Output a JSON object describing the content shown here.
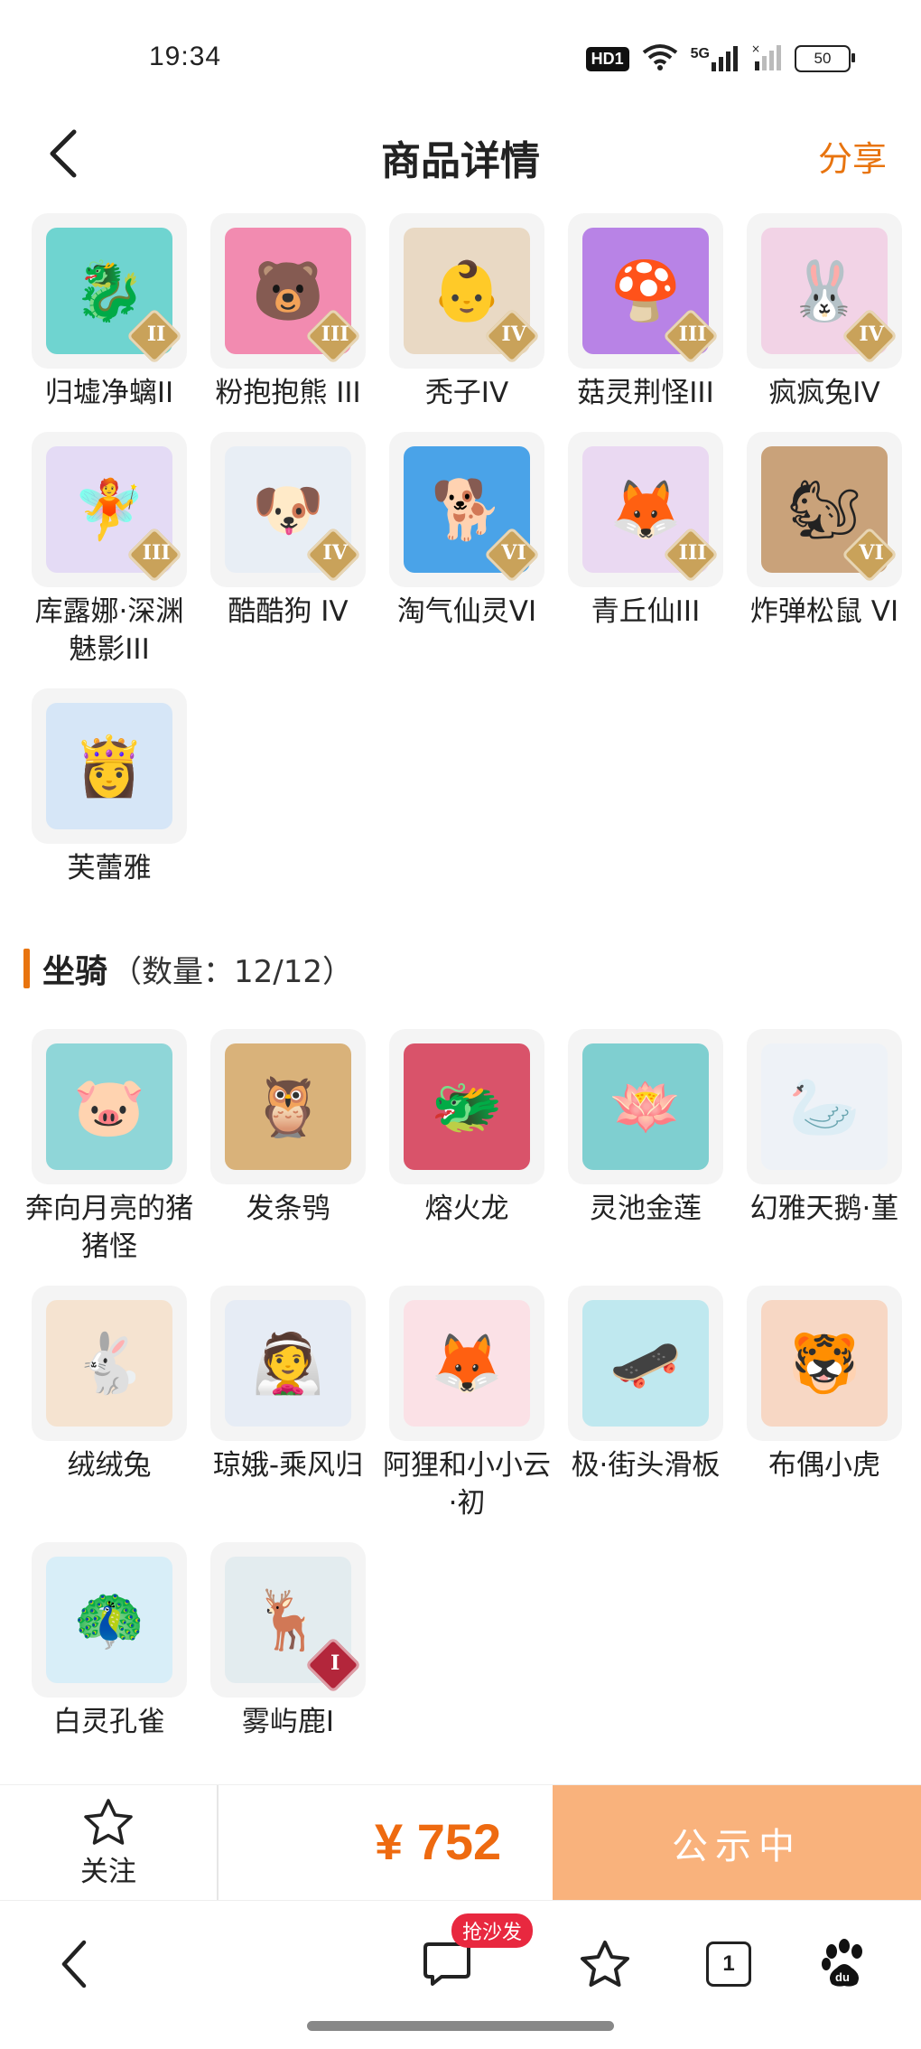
{
  "status_bar": {
    "time": "19:34",
    "hd_label": "HD1",
    "network_label": "5G",
    "battery": "50"
  },
  "header": {
    "title": "商品详情",
    "share_label": "分享"
  },
  "pets": {
    "items": [
      {
        "name": "归墟净螭II",
        "tier": "II",
        "color": "#6fd4d0",
        "emoji": "🐉"
      },
      {
        "name": "粉抱抱熊 III",
        "tier": "III",
        "color": "#f28bb0",
        "emoji": "🐻"
      },
      {
        "name": "秃子IV",
        "tier": "IV",
        "color": "#e9d9c4",
        "emoji": "👶"
      },
      {
        "name": "菇灵荆怪III",
        "tier": "III",
        "color": "#b883e6",
        "emoji": "🍄"
      },
      {
        "name": "疯疯兔IV",
        "tier": "IV",
        "color": "#f2d3e6",
        "emoji": "🐰"
      },
      {
        "name": "库露娜·深渊魅影III",
        "tier": "III",
        "color": "#e4dbf5",
        "emoji": "🧚"
      },
      {
        "name": "酷酷狗 IV",
        "tier": "IV",
        "color": "#e8eef5",
        "emoji": "🐶"
      },
      {
        "name": "淘气仙灵VI",
        "tier": "VI",
        "color": "#4aa3e8",
        "emoji": "🐕"
      },
      {
        "name": "青丘仙III",
        "tier": "III",
        "color": "#ead9f2",
        "emoji": "🦊"
      },
      {
        "name": "炸弹松鼠 VI",
        "tier": "VI",
        "color": "#c9a27a",
        "emoji": "🐿"
      },
      {
        "name": "芙蕾雅",
        "tier": "",
        "color": "#d6e6f7",
        "emoji": "👸"
      }
    ]
  },
  "mounts_section": {
    "title": "坐骑",
    "count_label": "（数量：12/12）"
  },
  "mounts": {
    "items": [
      {
        "name": "奔向月亮的猪猪怪",
        "tier": "",
        "color": "#8fd6d8",
        "emoji": "🐷"
      },
      {
        "name": "发条鸮",
        "tier": "",
        "color": "#d9b27a",
        "emoji": "🦉"
      },
      {
        "name": "熔火龙",
        "tier": "",
        "color": "#d9536a",
        "emoji": "🐲"
      },
      {
        "name": "灵池金莲",
        "tier": "",
        "color": "#7fcfd0",
        "emoji": "🪷"
      },
      {
        "name": "幻雅天鹅·堇",
        "tier": "",
        "color": "#eef2f7",
        "emoji": "🦢"
      },
      {
        "name": "绒绒兔",
        "tier": "",
        "color": "#f5e3d0",
        "emoji": "🐇"
      },
      {
        "name": "琼娥-乘风归",
        "tier": "",
        "color": "#e6ecf5",
        "emoji": "👰"
      },
      {
        "name": "阿狸和小小云·初",
        "tier": "",
        "color": "#fbe1e6",
        "emoji": "🦊"
      },
      {
        "name": "极·街头滑板",
        "tier": "",
        "color": "#bfe8ef",
        "emoji": "🛹"
      },
      {
        "name": "布偶小虎",
        "tier": "",
        "color": "#f7d7c4",
        "emoji": "🐯"
      },
      {
        "name": "白灵孔雀",
        "tier": "",
        "color": "#d8eef8",
        "emoji": "🦚"
      },
      {
        "name": "雾屿鹿I",
        "tier": "I",
        "color": "#e3ecef",
        "emoji": "🦌"
      }
    ]
  },
  "action_bar": {
    "follow_label": "关注",
    "price": "¥ 752",
    "status_label": "公示中"
  },
  "browser_bar": {
    "hot_badge": "抢沙发",
    "tabs_count": "1"
  },
  "colors": {
    "accent": "#e8740f",
    "price": "#ee6a10",
    "status_button": "#f9b27c",
    "badge_red": "#e8283f"
  }
}
